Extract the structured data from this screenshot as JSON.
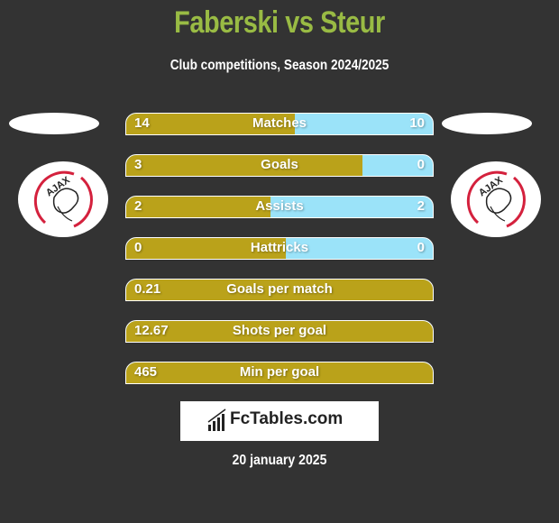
{
  "header": {
    "title": "Faberski vs Steur",
    "subtitle": "Club competitions, Season 2024/2025"
  },
  "teams": {
    "left": {
      "logo": "ajax-logo",
      "logo_text": "AJAX"
    },
    "right": {
      "logo": "ajax-logo",
      "logo_text": "AJAX"
    }
  },
  "colors": {
    "title": "#99bb44",
    "left_bar": "#baa21a",
    "right_bar": "#9be3f9",
    "background": "#333333"
  },
  "stats": [
    {
      "label": "Matches",
      "left": "14",
      "right": "10",
      "left_share": 0.55
    },
    {
      "label": "Goals",
      "left": "3",
      "right": "0",
      "left_share": 0.77
    },
    {
      "label": "Assists",
      "left": "2",
      "right": "2",
      "left_share": 0.47
    },
    {
      "label": "Hattricks",
      "left": "0",
      "right": "0",
      "left_share": 0.52
    },
    {
      "label": "Goals per match",
      "left": "0.21",
      "right": "",
      "left_share": 1
    },
    {
      "label": "Shots per goal",
      "left": "12.67",
      "right": "",
      "left_share": 1
    },
    {
      "label": "Min per goal",
      "left": "465",
      "right": "",
      "left_share": 1
    }
  ],
  "brand": {
    "name": "FcTables.com",
    "icon": "bar-chart-icon"
  },
  "footer": {
    "date": "20 january 2025"
  }
}
